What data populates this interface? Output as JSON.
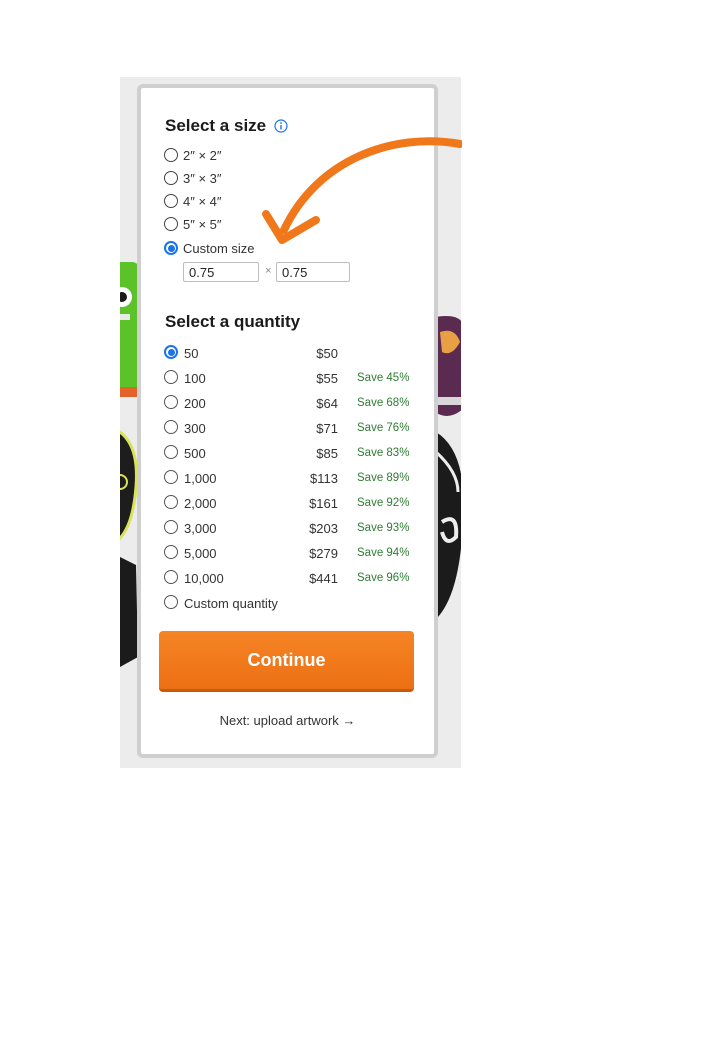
{
  "size_section": {
    "title": "Select a size",
    "options": [
      {
        "label": "2″ × 2″",
        "selected": false
      },
      {
        "label": "3″ × 3″",
        "selected": false
      },
      {
        "label": "4″ × 4″",
        "selected": false
      },
      {
        "label": "5″ × 5″",
        "selected": false
      },
      {
        "label": "Custom size",
        "selected": true
      }
    ],
    "custom_width": "0.75",
    "custom_height": "0.75",
    "separator": "×"
  },
  "quantity_section": {
    "title": "Select a quantity",
    "rows": [
      {
        "qty": "50",
        "price": "$50",
        "save": "",
        "selected": true
      },
      {
        "qty": "100",
        "price": "$55",
        "save": "Save 45%",
        "selected": false
      },
      {
        "qty": "200",
        "price": "$64",
        "save": "Save 68%",
        "selected": false
      },
      {
        "qty": "300",
        "price": "$71",
        "save": "Save 76%",
        "selected": false
      },
      {
        "qty": "500",
        "price": "$85",
        "save": "Save 83%",
        "selected": false
      },
      {
        "qty": "1,000",
        "price": "$113",
        "save": "Save 89%",
        "selected": false
      },
      {
        "qty": "2,000",
        "price": "$161",
        "save": "Save 92%",
        "selected": false
      },
      {
        "qty": "3,000",
        "price": "$203",
        "save": "Save 93%",
        "selected": false
      },
      {
        "qty": "5,000",
        "price": "$279",
        "save": "Save 94%",
        "selected": false
      },
      {
        "qty": "10,000",
        "price": "$441",
        "save": "Save 96%",
        "selected": false
      }
    ],
    "custom_label": "Custom quantity"
  },
  "actions": {
    "continue_label": "Continue",
    "next_label": "Next: upload artwork →"
  },
  "colors": {
    "accent_orange": "#f0781b",
    "radio_blue": "#1a73e8",
    "save_green": "#2e7d32"
  },
  "icons": {
    "info": "info-icon",
    "annotation": "orange-arrow"
  }
}
